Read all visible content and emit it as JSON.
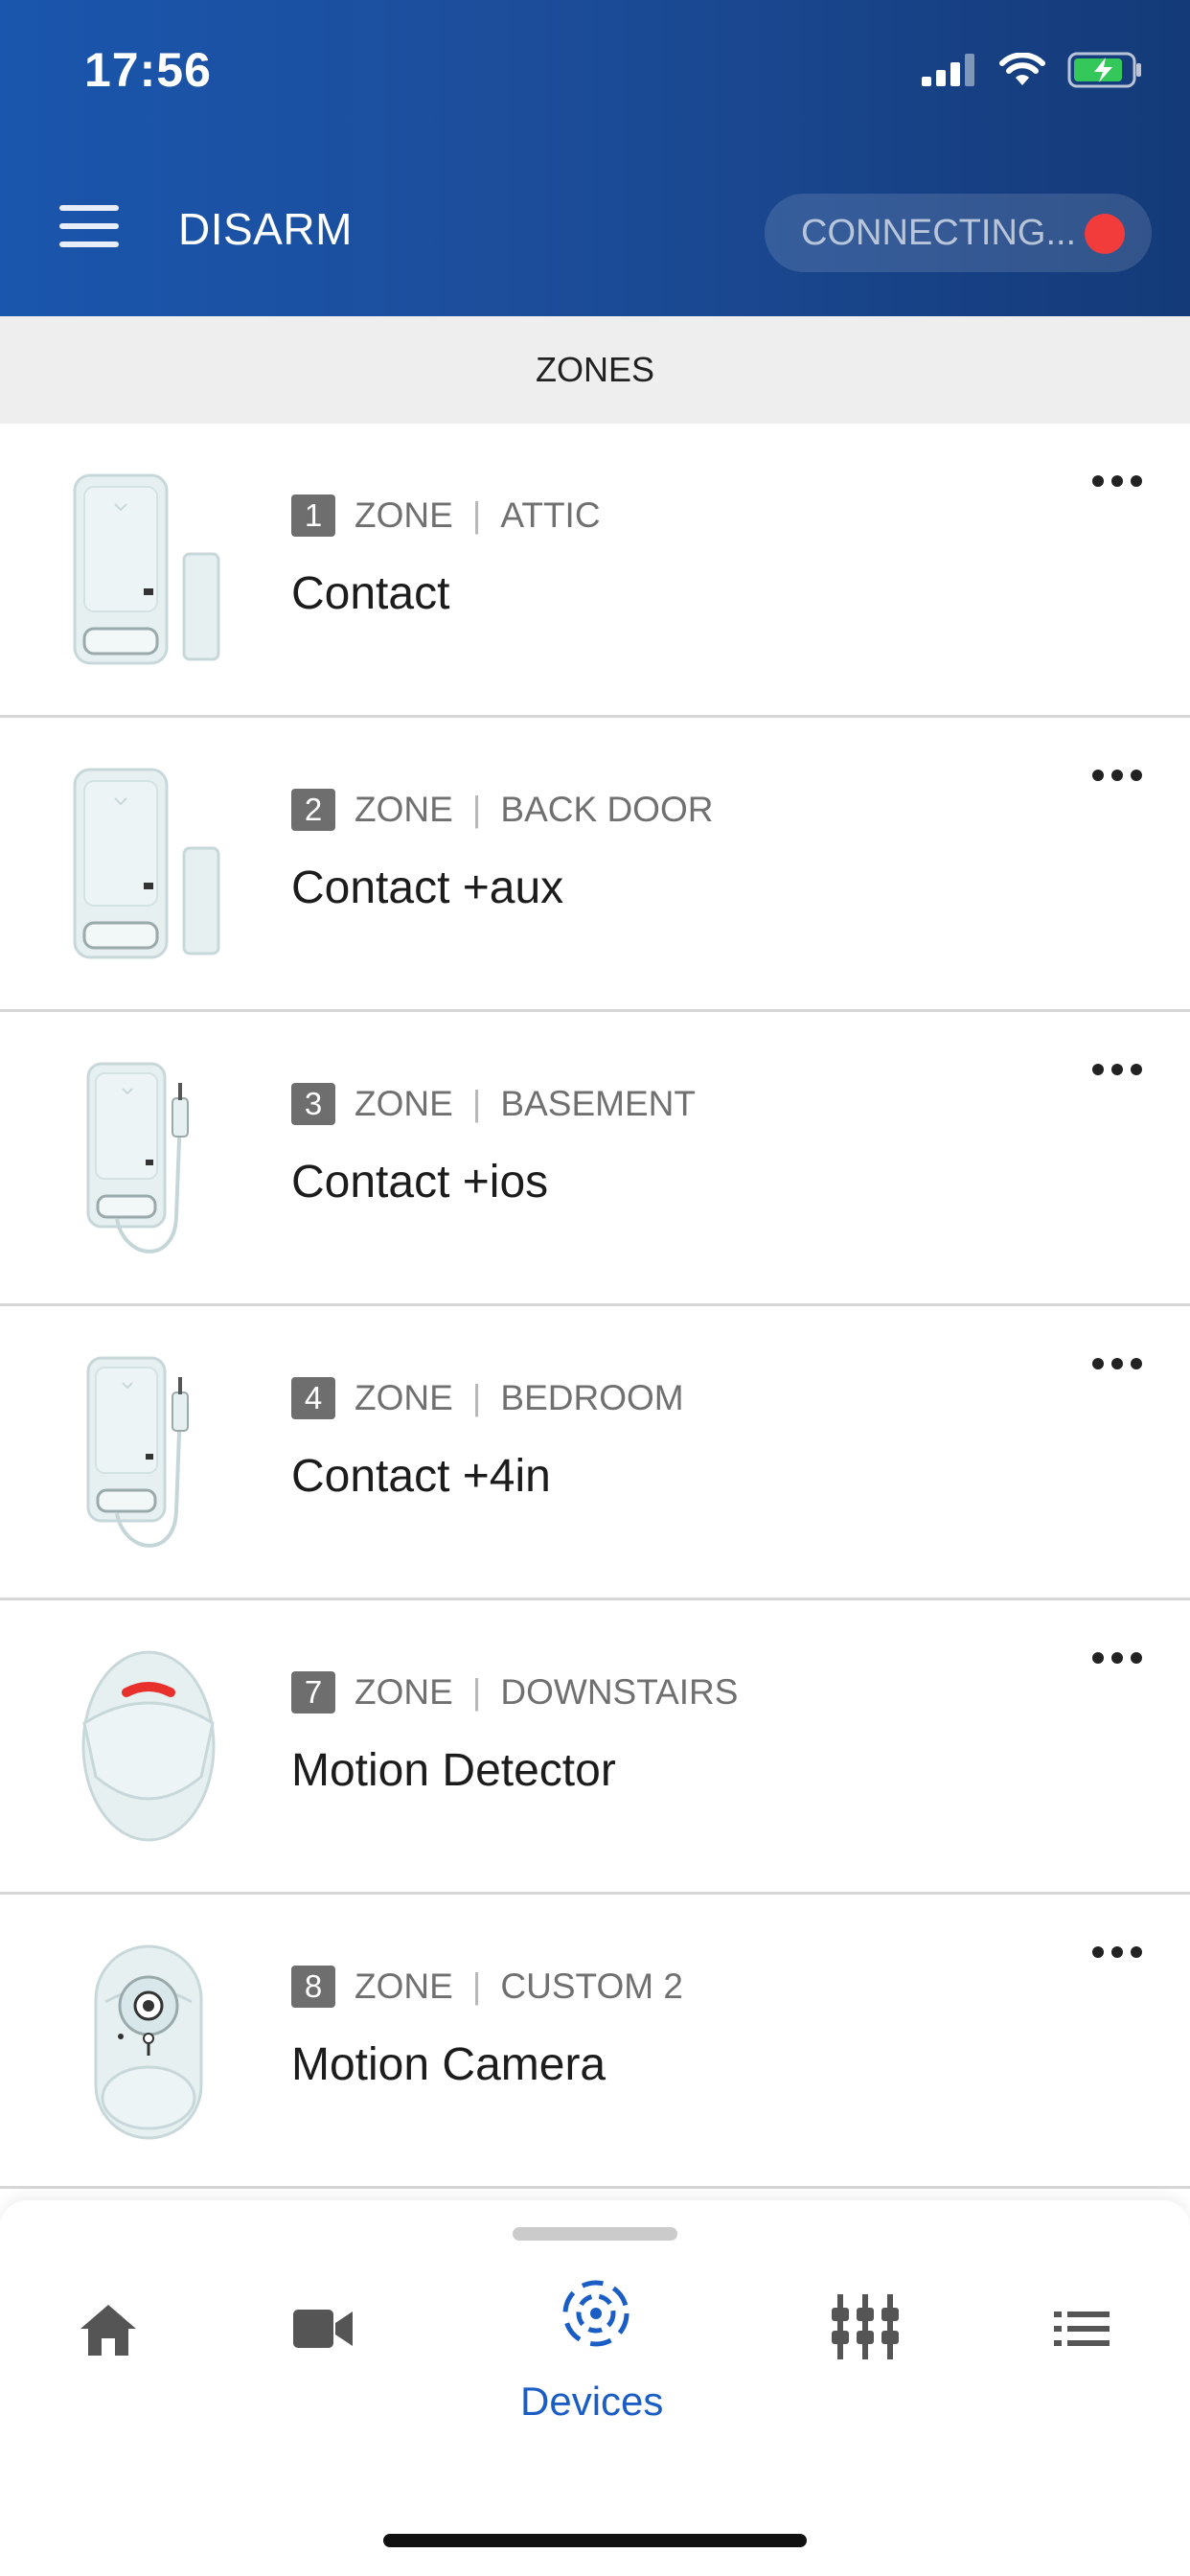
{
  "status_bar": {
    "time": "17:56"
  },
  "header": {
    "title": "DISARM",
    "connection_status": "CONNECTING...",
    "connection_color": "#f23c3c"
  },
  "section": {
    "title": "ZONES"
  },
  "zones": [
    {
      "number": "1",
      "zone_label": "ZONE",
      "location": "ATTIC",
      "name": "Contact",
      "icon": "door-contact-sensor-icon"
    },
    {
      "number": "2",
      "zone_label": "ZONE",
      "location": "BACK DOOR",
      "name": "Contact +aux",
      "icon": "door-contact-sensor-icon"
    },
    {
      "number": "3",
      "zone_label": "ZONE",
      "location": "BASEMENT",
      "name": "Contact +ios",
      "icon": "wired-contact-sensor-icon"
    },
    {
      "number": "4",
      "zone_label": "ZONE",
      "location": "BEDROOM",
      "name": "Contact +4in",
      "icon": "wired-contact-sensor-icon"
    },
    {
      "number": "7",
      "zone_label": "ZONE",
      "location": "DOWNSTAIRS",
      "name": "Motion Detector",
      "icon": "motion-detector-icon"
    },
    {
      "number": "8",
      "zone_label": "ZONE",
      "location": "CUSTOM 2",
      "name": "Motion Camera",
      "icon": "motion-camera-icon"
    }
  ],
  "tab_bar": {
    "tabs": [
      {
        "icon": "home-icon",
        "label": ""
      },
      {
        "icon": "video-camera-icon",
        "label": ""
      },
      {
        "icon": "devices-icon",
        "label": "Devices",
        "active": true
      },
      {
        "icon": "automation-icon",
        "label": ""
      },
      {
        "icon": "list-icon",
        "label": ""
      }
    ],
    "active_color": "#1a5ec5"
  }
}
